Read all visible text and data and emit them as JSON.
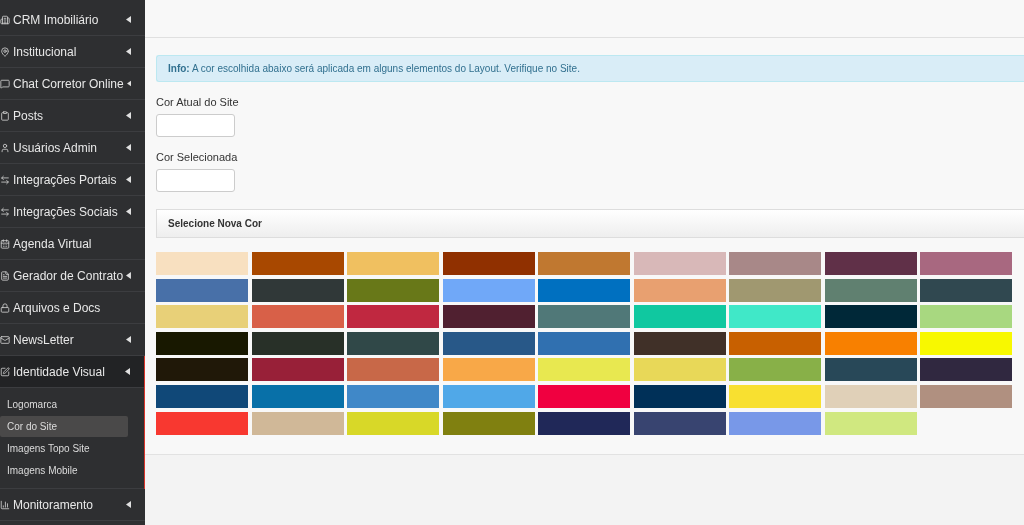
{
  "sidebar": {
    "items": [
      {
        "label": "CRM Imobiliário",
        "has_submenu": true,
        "expanded": false
      },
      {
        "label": "Institucional",
        "has_submenu": true,
        "expanded": false
      },
      {
        "label": "Chat Corretor Online",
        "has_submenu": true,
        "expanded": false
      },
      {
        "label": "Posts",
        "has_submenu": true,
        "expanded": false
      },
      {
        "label": "Usuários Admin",
        "has_submenu": true,
        "expanded": false
      },
      {
        "label": "Integrações Portais",
        "has_submenu": true,
        "expanded": false
      },
      {
        "label": "Integrações Sociais",
        "has_submenu": true,
        "expanded": false
      },
      {
        "label": "Agenda Virtual",
        "has_submenu": false,
        "expanded": false
      },
      {
        "label": "Gerador de Contrato",
        "has_submenu": true,
        "expanded": false
      },
      {
        "label": "Arquivos e Docs",
        "has_submenu": false,
        "expanded": false
      },
      {
        "label": "NewsLetter",
        "has_submenu": true,
        "expanded": false
      },
      {
        "label": "Identidade Visual",
        "has_submenu": true,
        "expanded": true,
        "children": [
          {
            "label": "Logomarca",
            "selected": false
          },
          {
            "label": "Cor do Site",
            "selected": true
          },
          {
            "label": "Imagens Topo Site",
            "selected": false
          },
          {
            "label": "Imagens Mobile",
            "selected": false
          }
        ]
      },
      {
        "label": "Monitoramento",
        "has_submenu": true,
        "expanded": false
      }
    ]
  },
  "info": {
    "label": "Info:",
    "text": "A cor escolhida abaixo será aplicada em alguns elementos do Layout. Verifique no Site."
  },
  "fields": [
    {
      "label": "Cor Atual do Site"
    },
    {
      "label": "Cor Selecionada"
    }
  ],
  "palette": {
    "title": "Selecione Nova Cor",
    "swatches": [
      {
        "color": "#f8e0c0"
      },
      {
        "color": "#a84800"
      },
      {
        "color": "#f0c060"
      },
      {
        "color": "#903000"
      },
      {
        "color": "#c07830"
      },
      {
        "color": "#d8b8b8"
      },
      {
        "color": "#a88888"
      },
      {
        "color": "#603048"
      },
      {
        "color": "#a86880"
      },
      {
        "color": "#4870a8"
      },
      {
        "color": "#303838"
      },
      {
        "color": "#687818"
      },
      {
        "color": "#70a8f8"
      },
      {
        "color": "#0070c0"
      },
      {
        "color": "#e8a070"
      },
      {
        "color": "#a09870"
      },
      {
        "color": "#608070"
      },
      {
        "color": "#304850"
      },
      {
        "color": "#e8d078"
      },
      {
        "color": "#d86048"
      },
      {
        "color": "#c02840"
      },
      {
        "color": "#502030"
      },
      {
        "color": "#507878"
      },
      {
        "color": "#10c8a0"
      },
      {
        "color": "#40e8c8"
      },
      {
        "color": "#002838"
      },
      {
        "color": "#a8d880"
      },
      {
        "color": "#181800"
      },
      {
        "color": "#283028"
      },
      {
        "color": "#304848"
      },
      {
        "color": "#285888"
      },
      {
        "color": "#3070b0"
      },
      {
        "color": "#403028"
      },
      {
        "color": "#c86000"
      },
      {
        "color": "#f88000"
      },
      {
        "color": "#f8f800"
      },
      {
        "color": "#201808"
      },
      {
        "color": "#982038"
      },
      {
        "color": "#c86848"
      },
      {
        "color": "#f8a848"
      },
      {
        "color": "#e8e850"
      },
      {
        "color": "#e8d858"
      },
      {
        "color": "#88b048"
      },
      {
        "color": "#284858"
      },
      {
        "color": "#302840"
      },
      {
        "color": "#104878"
      },
      {
        "color": "#0870a8"
      },
      {
        "color": "#4088c8"
      },
      {
        "color": "#50a8e8"
      },
      {
        "color": "#f00040"
      },
      {
        "color": "#003058"
      },
      {
        "color": "#f8e030"
      },
      {
        "color": "#e0d0b8"
      },
      {
        "color": "#b09080"
      },
      {
        "color": "#f83830"
      },
      {
        "color": "#d0b898"
      },
      {
        "color": "#d8d828"
      },
      {
        "color": "#808010"
      },
      {
        "color": "#202858"
      },
      {
        "color": "#384470"
      },
      {
        "color": "#7898e8"
      },
      {
        "color": "#d0e880"
      }
    ]
  }
}
